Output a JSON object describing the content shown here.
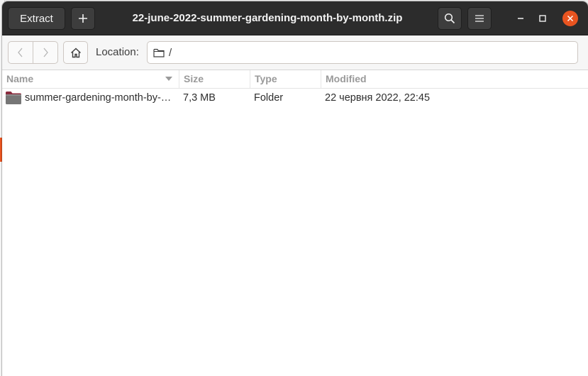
{
  "header": {
    "extract_label": "Extract",
    "add_icon": "plus-icon",
    "title": "22-june-2022-summer-gardening-month-by-month.zip",
    "search_icon": "search-icon",
    "menu_icon": "hamburger-menu-icon",
    "window_controls": [
      "minimize-icon",
      "maximize-icon",
      "close-icon"
    ]
  },
  "toolbar": {
    "back_icon": "chevron-left-icon",
    "forward_icon": "chevron-right-icon",
    "home_icon": "home-icon",
    "location_label": "Location:",
    "location_icon": "folder-icon",
    "location_value": "/"
  },
  "columns": {
    "name": "Name",
    "size": "Size",
    "type": "Type",
    "modified": "Modified"
  },
  "rows": [
    {
      "icon": "folder-icon",
      "name": "summer-gardening-month-by-…",
      "size": "7,3 MB",
      "type": "Folder",
      "modified": "22 червня 2022, 22:45"
    }
  ],
  "colors": {
    "header_bg": "#2c2c2c",
    "close_button": "#e95420",
    "folder_icon": "#7a6a6c"
  }
}
